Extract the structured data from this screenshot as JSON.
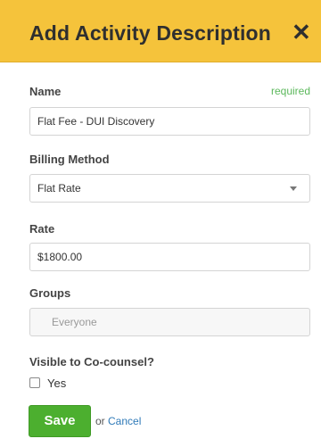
{
  "dialog": {
    "title": "Add Activity Description",
    "close_icon": "close-icon",
    "close_glyph": "✕"
  },
  "form": {
    "name": {
      "label": "Name",
      "required_text": "required",
      "value": "Flat Fee - DUI Discovery"
    },
    "billing_method": {
      "label": "Billing Method",
      "selected": "Flat Rate",
      "icon": "chevron-down-icon"
    },
    "rate": {
      "label": "Rate",
      "value": "$1800.00"
    },
    "groups": {
      "label": "Groups",
      "placeholder": "Everyone"
    },
    "visible": {
      "label": "Visible to Co-counsel?",
      "option_label": "Yes",
      "checked": false
    }
  },
  "actions": {
    "save_label": "Save",
    "or_text": "or",
    "cancel_label": "Cancel"
  },
  "colors": {
    "header_bg": "#f5c33b",
    "save_bg": "#4caf2f",
    "required": "#5cb85c",
    "link": "#2f7ab8"
  }
}
